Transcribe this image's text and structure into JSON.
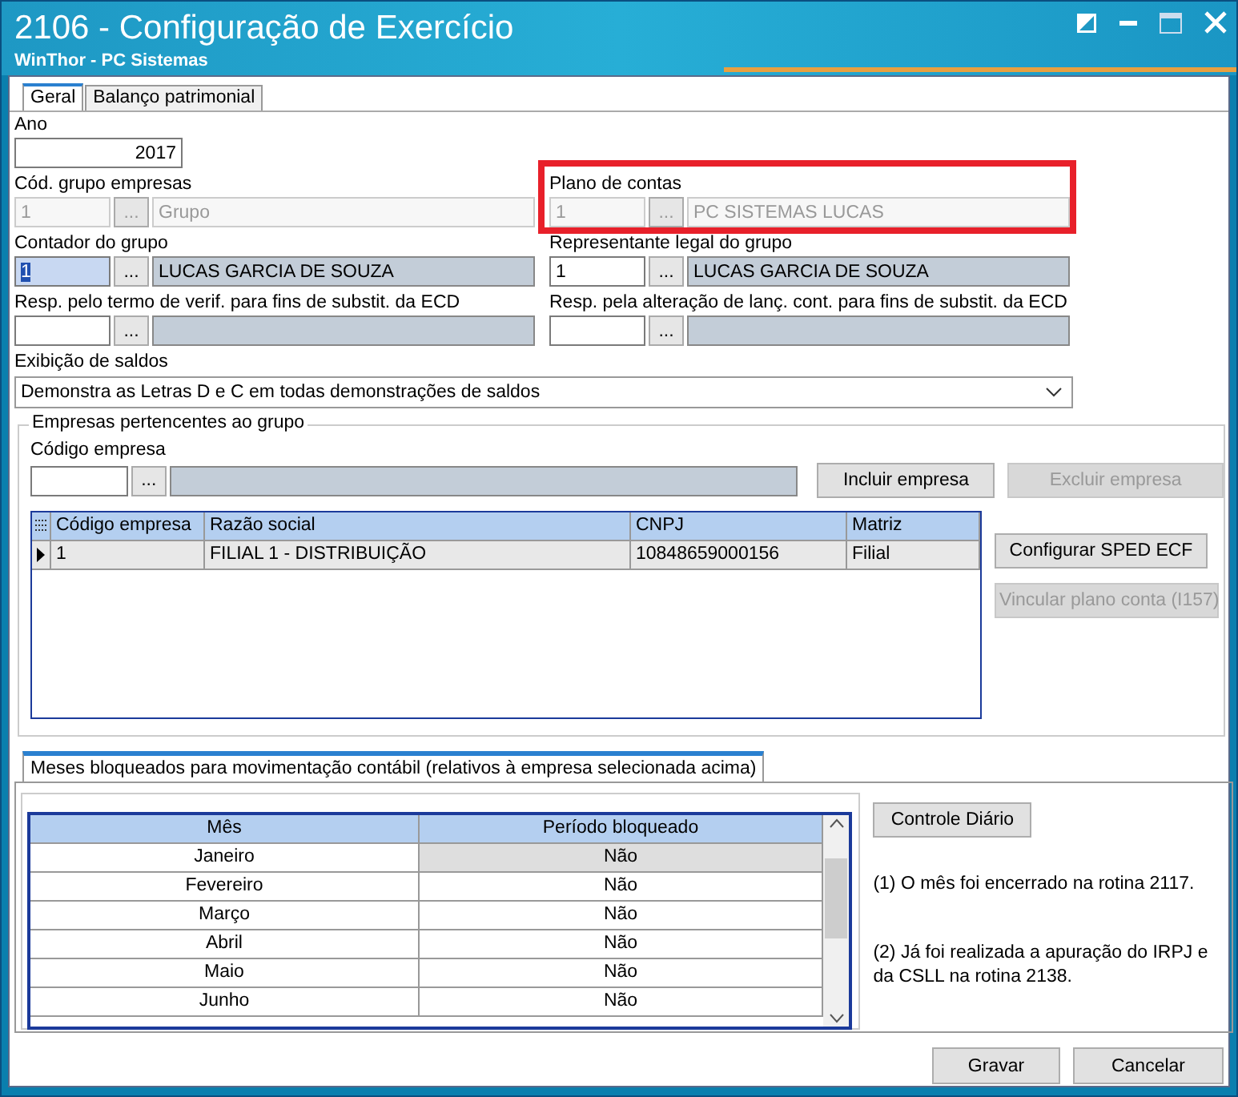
{
  "window": {
    "title": "2106 - Configuração de Exercício",
    "subtitle": "WinThor - PC Sistemas"
  },
  "tabs": [
    {
      "label": "Geral",
      "selected": true
    },
    {
      "label": "Balanço patrimonial",
      "selected": false
    }
  ],
  "ano": {
    "label": "Ano",
    "value": "2017"
  },
  "lookups": [
    {
      "label": "Cód. grupo empresas",
      "code": "1",
      "button": "...",
      "description": "Grupo",
      "disabled": true,
      "focused": false,
      "highlighted": false
    },
    {
      "label": "Plano de contas",
      "code": "1",
      "button": "...",
      "description": "PC SISTEMAS LUCAS",
      "disabled": true,
      "focused": false,
      "highlighted": true
    },
    {
      "label": "Contador do grupo",
      "code": "1",
      "button": "...",
      "description": "LUCAS GARCIA DE SOUZA",
      "disabled": false,
      "focused": true,
      "highlighted": false
    },
    {
      "label": "Representante legal do grupo",
      "code": "1",
      "button": "...",
      "description": "LUCAS GARCIA DE SOUZA",
      "disabled": false,
      "focused": false,
      "highlighted": false
    },
    {
      "label": "Resp. pelo termo de verif. para fins de substit. da ECD",
      "button": "...",
      "disabled": false,
      "focused": false,
      "highlighted": false
    },
    {
      "label": "Resp. pela alteração de lanç. cont. para fins de substit. da ECD",
      "button": "...",
      "disabled": false,
      "focused": false,
      "highlighted": false
    }
  ],
  "saldos": {
    "label": "Exibição de saldos",
    "value": "Demonstra as Letras D e C em todas demonstrações de saldos"
  },
  "empresas": {
    "title": "Empresas pertencentes ao grupo",
    "code_label": "Código empresa",
    "lookup_button": "...",
    "buttons": [
      {
        "label": "Incluir empresa",
        "disabled": false
      },
      {
        "label": "Excluir empresa",
        "disabled": true
      },
      {
        "label": "Configurar SPED ECF",
        "disabled": false
      },
      {
        "label": "Vincular plano conta (I157)",
        "disabled": true
      }
    ],
    "table": {
      "columns": [
        "Código empresa",
        "Razão social",
        "CNPJ",
        "Matriz"
      ],
      "rows": [
        {
          "cells": [
            "1",
            "FILIAL 1 - DISTRIBUIÇÃO",
            "10848659000156",
            "Filial"
          ],
          "selected": true
        }
      ]
    }
  },
  "meses": {
    "tab": {
      "label": "Meses bloqueados para movimentação contábil (relativos à empresa selecionada acima)",
      "selected": true
    },
    "columns": [
      "Mês",
      "Período bloqueado"
    ],
    "rows": [
      {
        "month": "Janeiro",
        "blocked": "Não",
        "selected": true
      },
      {
        "month": "Fevereiro",
        "blocked": "Não",
        "selected": false
      },
      {
        "month": "Março",
        "blocked": "Não",
        "selected": false
      },
      {
        "month": "Abril",
        "blocked": "Não",
        "selected": false
      },
      {
        "month": "Maio",
        "blocked": "Não",
        "selected": false
      },
      {
        "month": "Junho",
        "blocked": "Não",
        "selected": false
      }
    ],
    "button": "Controle Diário",
    "notes": [
      "(1)  O mês foi encerrado na rotina 2117.",
      "(2)  Já foi realizada a apuração do IRPJ e da CSLL na rotina 2138."
    ]
  },
  "actions": [
    "Gravar",
    "Cancelar"
  ]
}
